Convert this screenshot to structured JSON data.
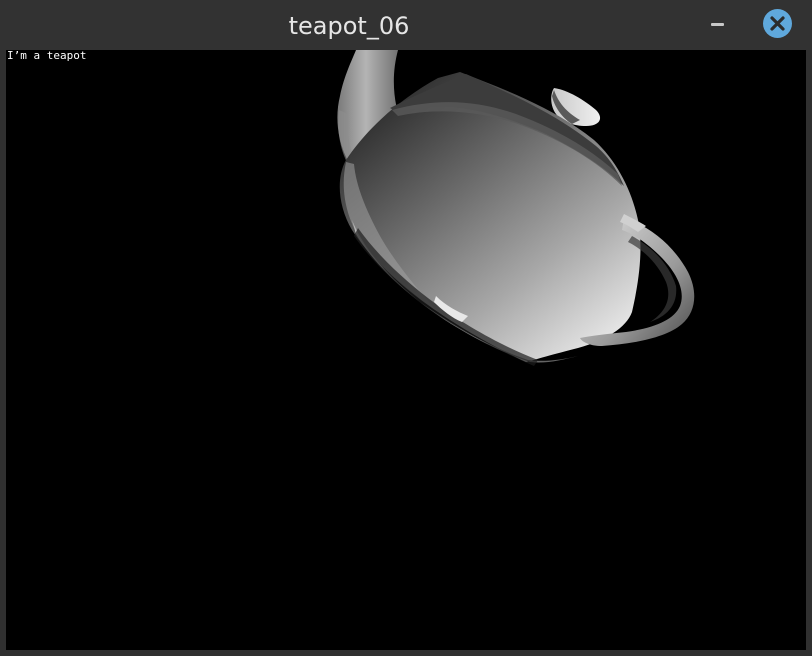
{
  "window": {
    "title": "teapot_06"
  },
  "titlebar": {
    "minimize_icon": "minimize-icon",
    "close_icon": "close-icon",
    "accent_color": "#5fa8dc"
  },
  "viewport": {
    "overlay_text": "I’m a teapot",
    "background_color": "#000000"
  }
}
